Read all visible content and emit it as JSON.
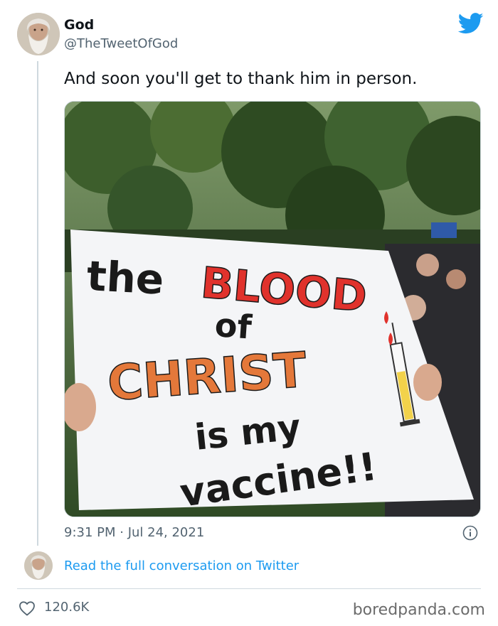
{
  "tweet": {
    "author_name": "God",
    "author_handle": "@TheTweetOfGod",
    "text": "And soon you'll get to thank him in person.",
    "timestamp": "9:31 PM · Jul 24, 2021",
    "read_more": "Read the full conversation on Twitter",
    "like_count": "120.6K"
  },
  "media": {
    "sign_line1_a": "the",
    "sign_line1_b": "BLOOD",
    "sign_line2": "of",
    "sign_line3": "CHRIST",
    "sign_line4": "is my",
    "sign_line5": "vaccine!!"
  },
  "watermark": "boredpanda.com",
  "colors": {
    "link": "#1d9bf0",
    "secondary_text": "#536471",
    "sign_red": "#e0322c",
    "sign_orange": "#e4783a"
  },
  "icons": [
    "twitter-bird-icon",
    "info-icon",
    "heart-icon"
  ]
}
